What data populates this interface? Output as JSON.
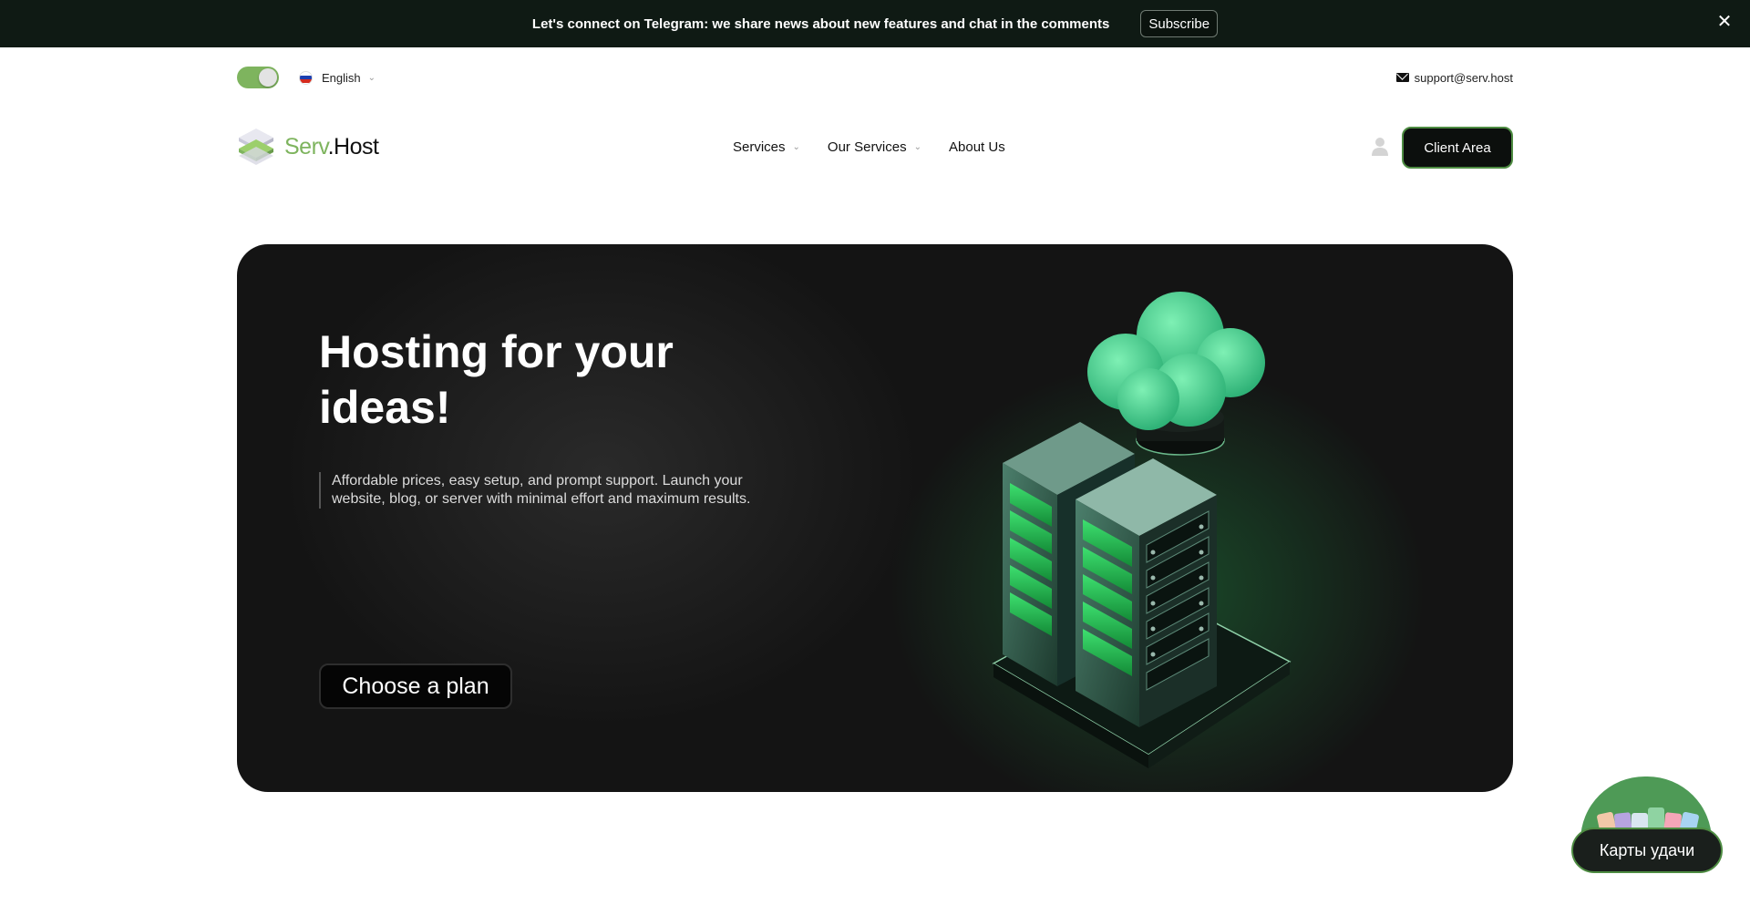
{
  "announcement": {
    "text": "Let's connect on Telegram: we share news about new features and chat in the comments",
    "button": "Subscribe",
    "close": "✕"
  },
  "utility": {
    "language": "English",
    "email": "support@serv.host"
  },
  "brand": {
    "part1": "Serv",
    "part2": ".Host",
    "accent_color": "#7eb45e"
  },
  "nav": {
    "items": [
      {
        "label": "Services",
        "has_dropdown": true
      },
      {
        "label": "Our Services",
        "has_dropdown": true
      },
      {
        "label": "About Us",
        "has_dropdown": false
      }
    ],
    "client_area": "Client Area"
  },
  "hero": {
    "title": "Hosting for your ideas!",
    "description": "Affordable prices, easy setup, and prompt support. Launch your website, blog, or server with minimal effort and maximum results.",
    "cta": "Choose a plan"
  },
  "widget": {
    "label": "Карты удачи"
  }
}
